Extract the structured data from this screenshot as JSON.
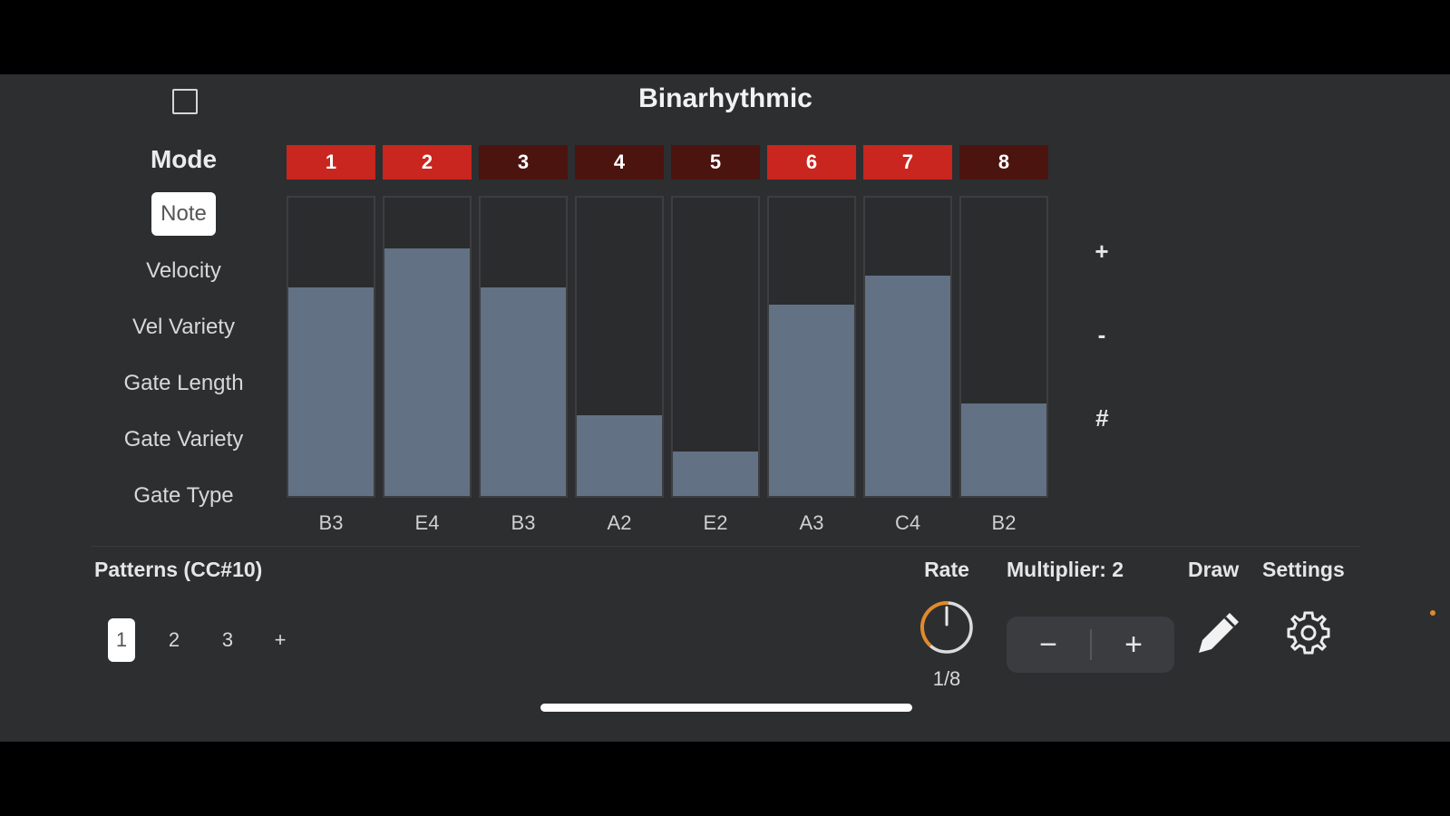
{
  "app": {
    "title": "Binarhythmic"
  },
  "mode": {
    "heading": "Mode",
    "options": [
      {
        "label": "Note",
        "selected": true
      },
      {
        "label": "Velocity",
        "selected": false
      },
      {
        "label": "Vel Variety",
        "selected": false
      },
      {
        "label": "Gate Length",
        "selected": false
      },
      {
        "label": "Gate Variety",
        "selected": false
      },
      {
        "label": "Gate Type",
        "selected": false
      }
    ]
  },
  "steps": [
    {
      "label": "1",
      "active": true,
      "level": 0.7,
      "note": "B3"
    },
    {
      "label": "2",
      "active": true,
      "level": 0.83,
      "note": "E4"
    },
    {
      "label": "3",
      "active": false,
      "level": 0.7,
      "note": "B3"
    },
    {
      "label": "4",
      "active": false,
      "level": 0.27,
      "note": "A2"
    },
    {
      "label": "5",
      "active": false,
      "level": 0.15,
      "note": "E2"
    },
    {
      "label": "6",
      "active": true,
      "level": 0.64,
      "note": "A3"
    },
    {
      "label": "7",
      "active": true,
      "level": 0.74,
      "note": "C4"
    },
    {
      "label": "8",
      "active": false,
      "level": 0.31,
      "note": "B2"
    }
  ],
  "side_controls": {
    "plus": "+",
    "minus": "-",
    "sharp": "#"
  },
  "patterns": {
    "label": "Patterns (CC#10)",
    "items": [
      {
        "label": "1",
        "selected": true
      },
      {
        "label": "2",
        "selected": false
      },
      {
        "label": "3",
        "selected": false
      }
    ],
    "add_label": "+"
  },
  "rate": {
    "label": "Rate",
    "value": "1/8"
  },
  "multiplier": {
    "label": "Multiplier: 2",
    "minus": "−",
    "plus": "+"
  },
  "draw": {
    "label": "Draw"
  },
  "settings": {
    "label": "Settings"
  },
  "colors": {
    "step_on": "#c8261e",
    "step_off": "#4b140f",
    "fill": "#627184",
    "knob_accent": "#e08a2b"
  }
}
